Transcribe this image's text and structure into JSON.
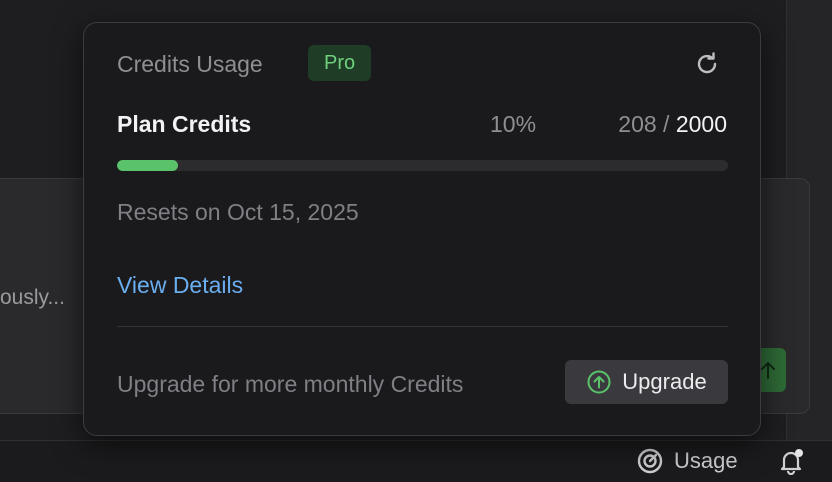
{
  "background": {
    "chat_placeholder": "ously..."
  },
  "status_bar": {
    "usage_label": "Usage"
  },
  "popover": {
    "title": "Credits Usage",
    "badge": "Pro",
    "plan_label": "Plan Credits",
    "percent_label": "10%",
    "credits_used": "208",
    "credits_separator": "/",
    "credits_total": "2000",
    "progress_fraction": 0.1,
    "reset_text": "Resets on Oct 15, 2025",
    "view_details_label": "View Details",
    "upgrade_prompt": "Upgrade for more monthly Credits",
    "upgrade_button_label": "Upgrade"
  },
  "colors": {
    "accent_green": "#5ac26a",
    "link_blue": "#6aaef0",
    "badge_bg": "#1f3d26",
    "badge_text": "#6fd07f"
  },
  "icons": {
    "refresh": "refresh-icon",
    "upgrade": "arrow-up-circle-icon",
    "usage": "gauge-icon",
    "bell": "bell-icon",
    "send": "arrow-up-icon"
  }
}
